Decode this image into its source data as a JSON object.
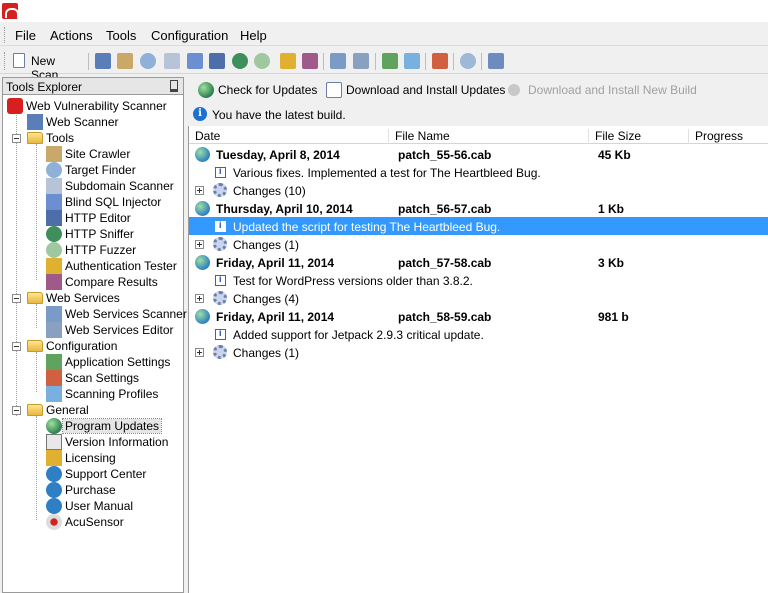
{
  "menu": [
    "File",
    "Actions",
    "Tools",
    "Configuration",
    "Help"
  ],
  "toolbar": {
    "new_scan": "New Scan",
    "icons": [
      "site-crawler-icon",
      "target-finder-icon",
      "search-icon",
      "subdomain-scanner-icon",
      "blind-sql-icon",
      "http-editor-icon",
      "http-sniffer-icon",
      "http-fuzzer-icon",
      "auth-tester-icon",
      "compare-results-icon",
      "web-services-scanner-icon",
      "web-services-editor-icon",
      "application-settings-icon",
      "scan-settings-icon",
      "scanning-profiles-icon",
      "scheduler-icon",
      "reporter-icon"
    ]
  },
  "explorer": {
    "title": "Tools Explorer",
    "root": "Web Vulnerability Scanner",
    "web_scanner": "Web Scanner",
    "groups": [
      {
        "label": "Tools",
        "items": [
          "Site Crawler",
          "Target Finder",
          "Subdomain Scanner",
          "Blind SQL Injector",
          "HTTP Editor",
          "HTTP Sniffer",
          "HTTP Fuzzer",
          "Authentication Tester",
          "Compare Results"
        ]
      },
      {
        "label": "Web Services",
        "items": [
          "Web Services Scanner",
          "Web Services Editor"
        ]
      },
      {
        "label": "Configuration",
        "items": [
          "Application Settings",
          "Scan Settings",
          "Scanning Profiles"
        ]
      },
      {
        "label": "General",
        "items": [
          "Program Updates",
          "Version Information",
          "Licensing",
          "Support Center",
          "Purchase",
          "User Manual",
          "AcuSensor"
        ]
      }
    ]
  },
  "actions": {
    "check": "Check for Updates",
    "download": "Download and Install Updates",
    "download_new": "Download and Install New Build"
  },
  "info": "You have the latest build.",
  "grid": {
    "columns": [
      "Date",
      "File Name",
      "File Size",
      "Progress"
    ],
    "updates": [
      {
        "date": "Tuesday, April 8, 2014",
        "file": "patch_55-56.cab",
        "size": "45 Kb",
        "desc": "Various fixes. Implemented a test for The Heartbleed Bug.",
        "changes": "Changes (10)"
      },
      {
        "date": "Thursday, April 10, 2014",
        "file": "patch_56-57.cab",
        "size": "1 Kb",
        "desc": "Updated the script for testing The Heartbleed Bug.",
        "changes": "Changes (1)"
      },
      {
        "date": "Friday, April 11, 2014",
        "file": "patch_57-58.cab",
        "size": "3 Kb",
        "desc": "Test for WordPress versions older than 3.8.2.",
        "changes": "Changes (4)"
      },
      {
        "date": "Friday, April 11, 2014",
        "file": "patch_58-59.cab",
        "size": "981 b",
        "desc": "Added support for Jetpack 2.9.3 critical update.",
        "changes": "Changes (1)"
      }
    ]
  }
}
